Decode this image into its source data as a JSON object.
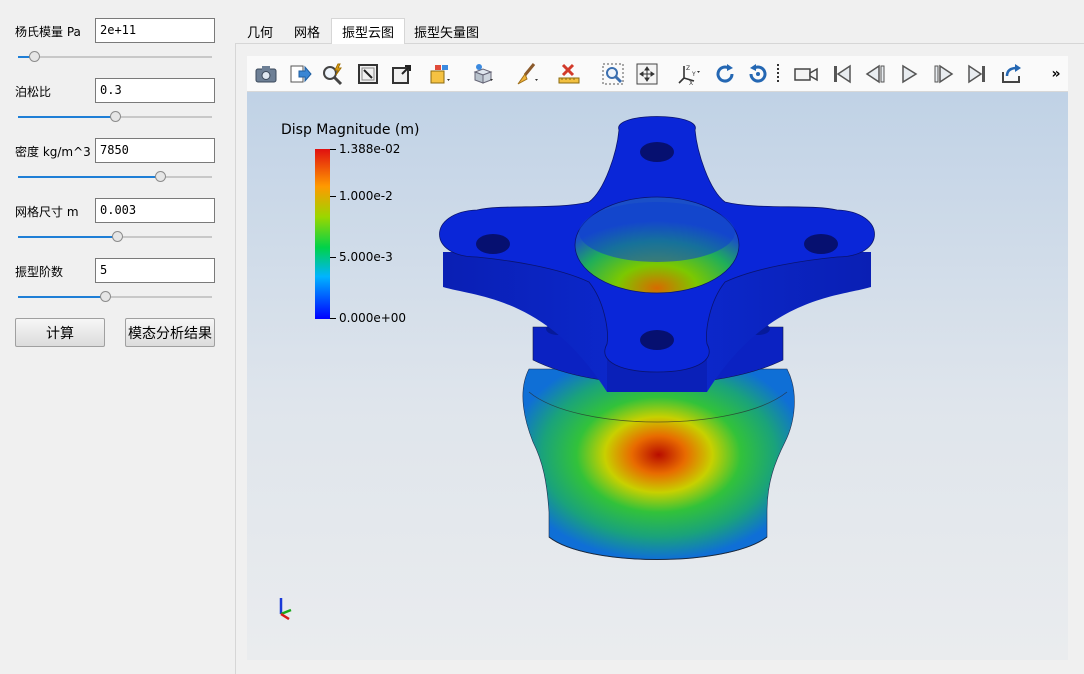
{
  "params": [
    {
      "label": "杨氏模量 Pa",
      "value": "2e+11",
      "slider": 0.08
    },
    {
      "label": "泊松比",
      "value": "0.3",
      "slider": 0.5
    },
    {
      "label": "密度 kg/m^3",
      "value": "7850",
      "slider": 0.73
    },
    {
      "label": "网格尺寸 m",
      "value": "0.003",
      "slider": 0.51
    },
    {
      "label": "振型阶数",
      "value": "5",
      "slider": 0.45
    }
  ],
  "buttons": {
    "compute": "计算",
    "results": "模态分析结果"
  },
  "tabs": [
    {
      "label": "几何",
      "active": false
    },
    {
      "label": "网格",
      "active": false
    },
    {
      "label": "振型云图",
      "active": true
    },
    {
      "label": "振型矢量图",
      "active": false
    }
  ],
  "toolbar": {
    "icons": [
      "camera-icon",
      "export-arrow-icon",
      "magnify-lightning-icon",
      "select-box-icon",
      "zoom-box-icon",
      "color-cube-icon",
      "render-cube-icon",
      "brush-icon",
      "delete-measure-icon",
      "zoom-to-box-icon",
      "fit-all-icon",
      "axes-icon",
      "rotate-cw-icon",
      "rotate-ccw-icon",
      "video-camera-icon",
      "first-frame-icon",
      "prev-frame-icon",
      "play-icon",
      "next-frame-icon",
      "last-frame-icon",
      "loop-icon"
    ],
    "overflow": "»"
  },
  "legend": {
    "title": "Disp Magnitude (m)",
    "max": "1.388e-02",
    "mid_high": "1.000e-2",
    "mid_low": "5.000e-3",
    "min": "0.000e+00"
  },
  "colors": {
    "accent": "#1f7fd6",
    "jet_low": "#0000ff",
    "jet_high": "#cc0000"
  }
}
